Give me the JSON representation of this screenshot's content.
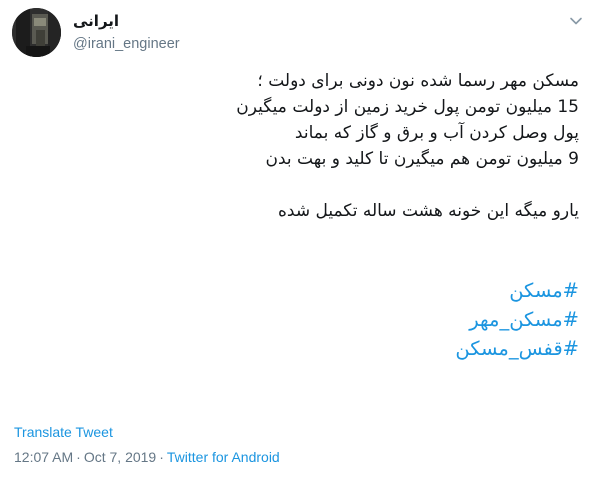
{
  "user": {
    "display_name": "ایرانی",
    "handle": "@irani_engineer",
    "avatar_icon": "profile-photo"
  },
  "menu": {
    "icon": "chevron-down-icon"
  },
  "tweet": {
    "lines": [
      "مسکن مهر رسما شده نون دونی برای دولت ؛",
      "15 میلیون تومن پول خرید زمین از دولت میگیرن",
      "پول وصل کردن آب و برق و گاز که بماند",
      "9 میلیون تومن هم میگیرن تا کلید و بهت بدن",
      "یارو میگه این خونه هشت ساله تکمیل شده"
    ],
    "hashtags": [
      "#مسکن",
      "#مسکن_مهر",
      "#قفس_مسکن"
    ]
  },
  "translate_label": "Translate Tweet",
  "meta": {
    "time": "12:07 AM",
    "separator": "·",
    "date": "Oct 7, 2019",
    "source": "Twitter for Android"
  },
  "colors": {
    "link": "#1b95e0",
    "secondary_text": "#657786",
    "primary_text": "#14171a"
  }
}
